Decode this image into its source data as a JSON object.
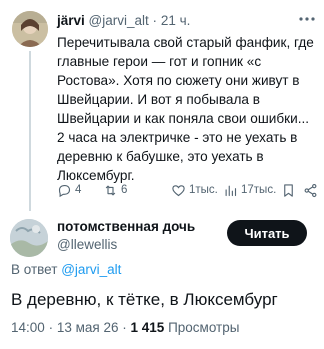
{
  "tweet1": {
    "name": "järvi",
    "handle": "@jarvi_alt",
    "time": "21 ч.",
    "text": "Перечитывала свой старый фанфик, где главные герои — гот и гопник «с Ростова». Хотя по сюжету они живут в Швейцарии. И вот я побывала в Швейцарии и как поняла свои ошибки... 2 часа на электричке - это не уехать в деревню к бабушке, это уехать в Люксембург.",
    "replies": "4",
    "retweets": "6",
    "likes": "1тыс.",
    "views": "17тыс."
  },
  "tweet2": {
    "name": "потомственная дочь",
    "handle": "@llewellis",
    "follow_label": "Читать",
    "reply_prefix": "В ответ",
    "reply_handle": "@jarvi_alt",
    "text": "В деревню, к тётке, в Люксембург",
    "time": "14:00",
    "date": "13 мая 26",
    "views_count": "1 415",
    "views_label": "Просмотры"
  },
  "colors": {
    "text": "#0f1419",
    "secondary": "#536471",
    "link": "#1d9bf0",
    "line": "#cfd9de",
    "button": "#0f1419"
  },
  "icons": [
    "more-icon",
    "reply-icon",
    "retweet-icon",
    "like-icon",
    "views-icon",
    "bookmark-icon",
    "share-icon"
  ]
}
